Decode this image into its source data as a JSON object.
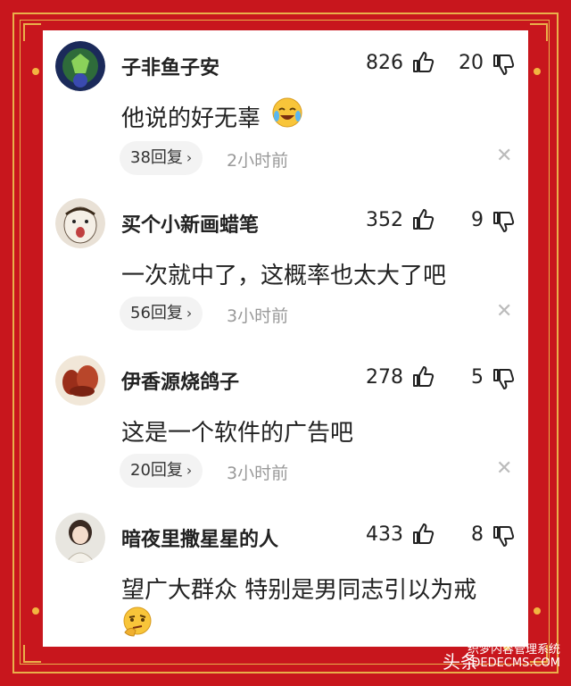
{
  "comments": [
    {
      "username": "子非鱼子安",
      "likes": "826",
      "dislikes": "20",
      "text": "他说的好无辜",
      "replies": "38回复",
      "time": "2小时前"
    },
    {
      "username": "买个小新画蜡笔",
      "likes": "352",
      "dislikes": "9",
      "text": "一次就中了，这概率也太大了吧",
      "replies": "56回复",
      "time": "3小时前"
    },
    {
      "username": "伊香源烧鸽子",
      "likes": "278",
      "dislikes": "5",
      "text": "这是一个软件的广告吧",
      "replies": "20回复",
      "time": "3小时前"
    },
    {
      "username": "暗夜里撒星星的人",
      "likes": "433",
      "dislikes": "8",
      "text": "望广大群众 特别是男同志引以为戒",
      "replies": "",
      "time": ""
    }
  ],
  "icons": {
    "like": "thumbs-up-icon",
    "dislike": "thumbs-down-icon",
    "close": "close-icon",
    "reply_arrow": "chevron-right-icon"
  },
  "colors": {
    "frame": "#c8161d",
    "gold": "#e9b04a",
    "text": "#222222",
    "muted": "#999999"
  },
  "watermark": {
    "prefix": "头条",
    "line1": "织梦内容管理系统",
    "line2": "DEDECMS.COM"
  }
}
